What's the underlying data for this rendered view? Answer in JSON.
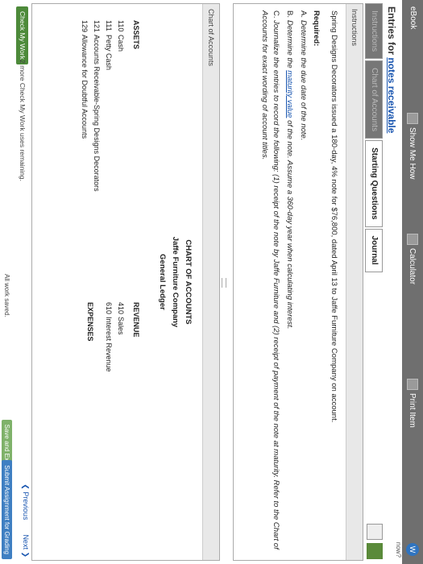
{
  "app": {
    "label": "eBook",
    "buttons": [
      {
        "label": "Show Me How",
        "icon": "video-icon"
      },
      {
        "label": "Calculator",
        "icon": "calculator-icon"
      },
      {
        "label": "Print Item",
        "icon": "print-icon"
      }
    ],
    "badge": "W",
    "badge_sub": "now?"
  },
  "page": {
    "title_prefix": "Entries for ",
    "title_link": "notes receivable"
  },
  "tabs": [
    {
      "label": "Instructions",
      "active": false
    },
    {
      "label": "Chart of Accounts",
      "active": false
    },
    {
      "label": "Starting Questions",
      "active": true
    },
    {
      "label": "Journal",
      "active": true
    }
  ],
  "instructions": {
    "header": "Instructions",
    "intro": "Spring Designs Decorators issued a 180-day, 4% note for $76,800, dated April 13 to Jaffe Furniture Company on account.",
    "required_title": "Required:",
    "items": [
      {
        "letter": "A.",
        "text": "Determine the due date of the note."
      },
      {
        "letter": "B.",
        "pre": "Determine the ",
        "link": "maturity value",
        "post": " of the note. Assume a 360-day year when calculating interest."
      },
      {
        "letter": "C.",
        "text": "Journalize the entries to record the following: (1) receipt of the note by Jaffe Furniture and (2) receipt of payment of the note at maturity. Refer to the Chart of Accounts for exact wording of account titles."
      }
    ]
  },
  "coa": {
    "header": "Chart of Accounts",
    "title": "CHART OF ACCOUNTS",
    "company": "Jaffe Furniture Company",
    "ledger": "General Ledger",
    "assets_title": "ASSETS",
    "assets": [
      {
        "no": "110",
        "name": "Cash"
      },
      {
        "no": "111",
        "name": "Petty Cash"
      },
      {
        "no": "121",
        "name": "Accounts Receivable-Spring Designs Decorators"
      },
      {
        "no": "129",
        "name": "Allowance for Doubtful Accounts"
      }
    ],
    "revenue_title": "REVENUE",
    "revenue": [
      {
        "no": "410",
        "name": "Sales"
      },
      {
        "no": "610",
        "name": "Interest Revenue"
      }
    ],
    "expenses_title": "EXPENSES"
  },
  "footer": {
    "check_label": "Check My Work",
    "check_info": "2 more Check My Work uses remaining.",
    "previous": "Previous",
    "next": "Next",
    "saved": "All work saved.",
    "save_exit": "Save and Exit",
    "submit": "Submit Assignment for Grading"
  },
  "colors": {
    "accent_link": "#1a56b0",
    "check_button": "#4d8a3a",
    "submit_button": "#3f7fc2",
    "toolbar": "#6f6f6f"
  }
}
